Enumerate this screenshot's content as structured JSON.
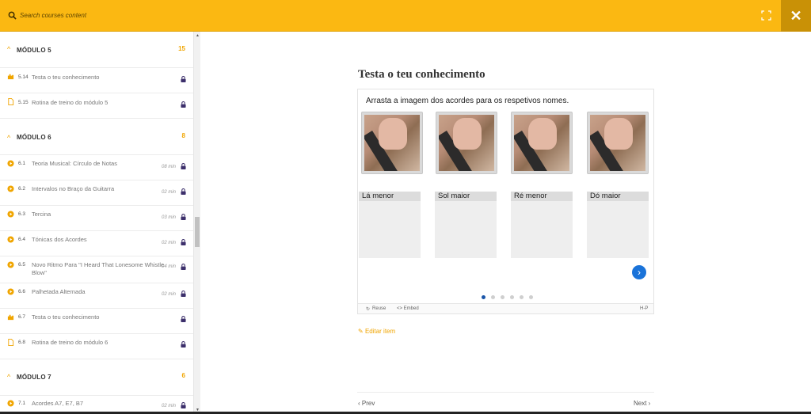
{
  "search": {
    "placeholder": "Search courses content"
  },
  "colors": {
    "accent": "#fbb812",
    "close_bg": "#c99106",
    "lock": "#3c2f6b",
    "link": "#f0a500",
    "next_btn": "#1a73d9"
  },
  "sidebar": {
    "modules": [
      {
        "title": "MÓDULO 5",
        "count": "15"
      },
      {
        "title": "MÓDULO 6",
        "count": "8"
      },
      {
        "title": "MÓDULO 7",
        "count": "6"
      }
    ],
    "lessons": [
      {
        "num": "5.14",
        "title": "Testa o teu conhecimento",
        "duration": "",
        "icon": "quiz-icon"
      },
      {
        "num": "5.15",
        "title": "Rotina de treino do módulo 5",
        "duration": "",
        "icon": "document-icon"
      },
      {
        "num": "6.1",
        "title": "Teoria Musical: Círculo de Notas",
        "duration": "08 min",
        "icon": "play-icon"
      },
      {
        "num": "6.2",
        "title": "Intervalos no Braço da Guitarra",
        "duration": "02 min",
        "icon": "play-icon"
      },
      {
        "num": "6.3",
        "title": "Tercina",
        "duration": "03 min",
        "icon": "play-icon"
      },
      {
        "num": "6.4",
        "title": "Tónicas dos Acordes",
        "duration": "02 min",
        "icon": "play-icon"
      },
      {
        "num": "6.5",
        "title": "Novo Ritmo Para \"I Heard That Lonesome Whistle Blow\"",
        "duration": "04 min",
        "icon": "play-icon"
      },
      {
        "num": "6.6",
        "title": "Palhetada Alternada",
        "duration": "02 min",
        "icon": "play-icon"
      },
      {
        "num": "6.7",
        "title": "Testa o teu conhecimento",
        "duration": "",
        "icon": "quiz-icon"
      },
      {
        "num": "6.8",
        "title": "Rotina de treino do módulo 6",
        "duration": "",
        "icon": "document-icon"
      },
      {
        "num": "7.1",
        "title": "Acordes A7, E7, B7",
        "duration": "02 min",
        "icon": "play-icon"
      }
    ]
  },
  "main": {
    "title": "Testa o teu conhecimento",
    "question": "Arrasta a imagem dos acordes para os respetivos nomes.",
    "dropzones": [
      "Lá menor",
      "Sol maior",
      "Ré menor",
      "Dó maior"
    ],
    "footer": {
      "reuse": "Reuse",
      "embed": "<> Embed",
      "brand": "H-P"
    },
    "edit_link": "Editar item",
    "prev": "Prev",
    "next": "Next"
  }
}
